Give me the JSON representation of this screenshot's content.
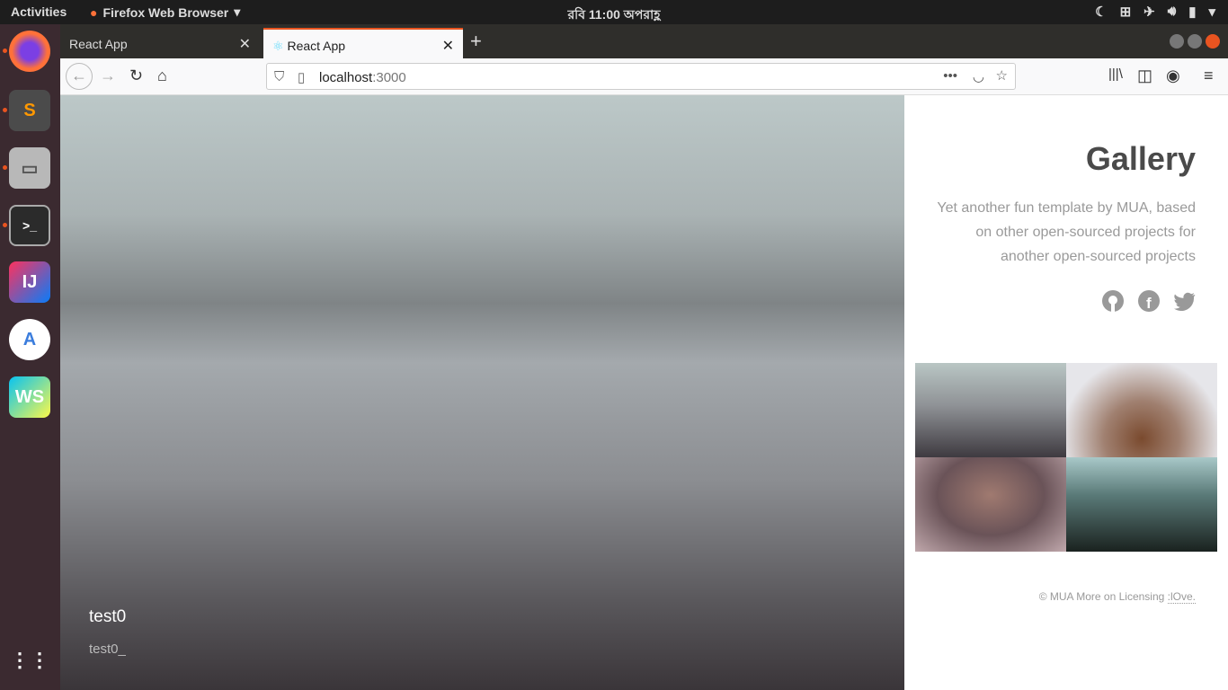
{
  "topbar": {
    "activities": "Activities",
    "app": "Firefox Web Browser",
    "clock": "রবি 11:00 অপরাহ্ণ"
  },
  "dock": {
    "items": [
      "firefox",
      "sublime-text",
      "files",
      "terminal",
      "intellij-idea",
      "android-studio",
      "webstorm",
      "show-applications"
    ]
  },
  "browser": {
    "tabs": [
      {
        "label": "React App",
        "active": false
      },
      {
        "label": "React App",
        "active": true
      }
    ],
    "url_host": "localhost",
    "url_port": ":3000"
  },
  "hero": {
    "title": "test0",
    "subtitle": "test0_"
  },
  "side": {
    "title": "Gallery",
    "description": "Yet another fun template by MUA, based on other open-sourced projects for another open-sourced projects",
    "social": [
      "github-icon",
      "facebook-icon",
      "twitter-icon"
    ],
    "footer": {
      "copy": "© MUA",
      "more": "More on Licensing",
      "love": ":lOve."
    }
  },
  "colors": {
    "accent": "#e95420",
    "title": "#4a4a4a",
    "muted": "#9a9a9a"
  }
}
